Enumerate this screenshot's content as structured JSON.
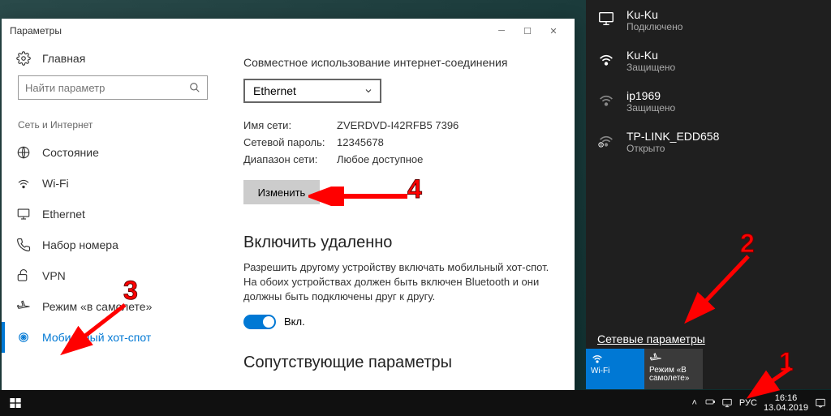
{
  "window": {
    "title": "Параметры",
    "home_label": "Главная",
    "search_placeholder": "Найти параметр",
    "category": "Сеть и Интернет",
    "nav": {
      "status": "Состояние",
      "wifi": "Wi-Fi",
      "ethernet": "Ethernet",
      "dialup": "Набор номера",
      "vpn": "VPN",
      "airplane": "Режим «в самолете»",
      "hotspot": "Мобильный хот-спот"
    }
  },
  "content": {
    "sharing_title": "Совместное использование интернет-соединения",
    "sharing_dropdown": "Ethernet",
    "name_label": "Имя сети:",
    "name_value": "ZVERDVD-I42RFB5 7396",
    "password_label": "Сетевой пароль:",
    "password_value": "12345678",
    "band_label": "Диапазон сети:",
    "band_value": "Любое доступное",
    "edit_button": "Изменить",
    "remote_title": "Включить удаленно",
    "remote_desc": "Разрешить другому устройству включать мобильный хот-спот. На обоих устройствах должен быть включен Bluetooth и они должны быть подключены друг к другу.",
    "toggle_label": "Вкл.",
    "related_title": "Сопутствующие параметры"
  },
  "flyout": {
    "networks": [
      {
        "name": "Ku-Ku",
        "status": "Подключено",
        "icon": "ethernet"
      },
      {
        "name": "Ku-Ku",
        "status": "Защищено",
        "icon": "wifi"
      },
      {
        "name": "ip1969",
        "status": "Защищено",
        "icon": "wifi-dim"
      },
      {
        "name": "TP-LINK_EDD658",
        "status": "Открыто",
        "icon": "wifi-open"
      }
    ],
    "settings_link": "Сетевые параметры",
    "tile_wifi": "Wi-Fi",
    "tile_airplane": "Режим «В самолете»"
  },
  "taskbar": {
    "lang": "РУС",
    "time": "16:16",
    "date": "13.04.2019"
  },
  "annotations": {
    "n1": "1",
    "n2": "2",
    "n3": "3",
    "n4": "4"
  }
}
